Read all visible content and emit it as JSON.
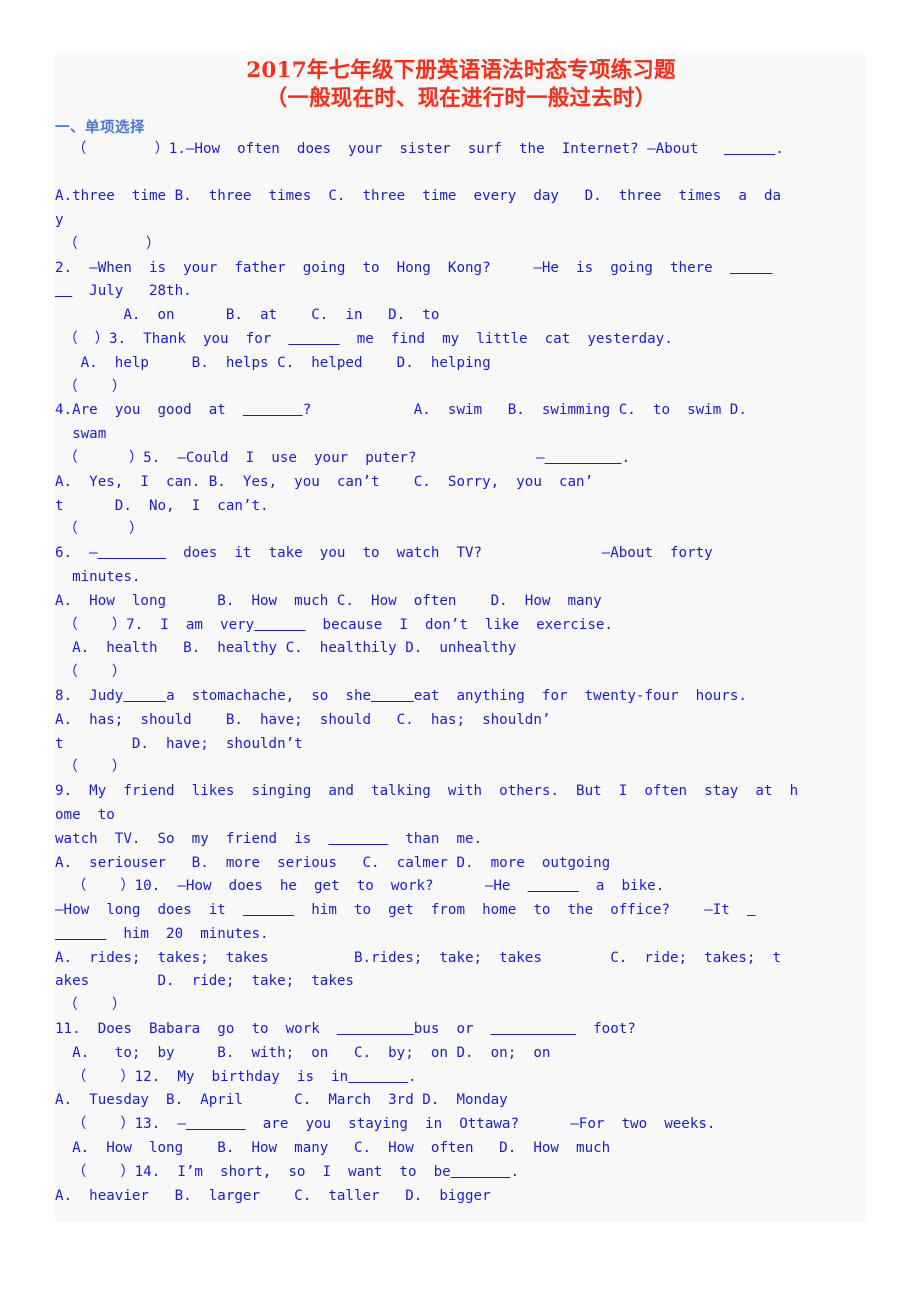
{
  "document": {
    "title_line_1": "2017年七年级下册英语语法时态专项练习题",
    "title_line_2": "（一般现在时、现在进行时一般过去时）",
    "section_heading": "一、单项选择",
    "colors": {
      "title_red": "#ff2a14",
      "body_blue": "#1a1ae0",
      "heading_blue": "#4a78d8",
      "page_background": "#f8f8f8",
      "canvas_background": "#ffffff"
    },
    "lines": [
      "  （        ）1.—How  often  does  your  sister  surf  the  Internet? —About   ______.",
      "",
      "A.three  time B.  three  times  C.  three  time  every  day   D.  three  times  a  da",
      "y",
      " （        ）",
      "2.  —When  is  your  father  going  to  Hong  Kong?     —He  is  going  there  _____",
      "__  July   28th.",
      "        A.  on      B.  at    C.  in   D.  to",
      " （  ）3.  Thank  you  for  ______  me  find  my  little  cat  yesterday.",
      "   A.  help     B.  helps C.  helped    D.  helping",
      " （    ）",
      "4.Are  you  good  at  _______?            A.  swim   B.  swimming C.  to  swim D.",
      "  swam",
      " （      ）5.  —Could  I  use  your  puter?              —_________.",
      "A.  Yes,  I  can. B.  Yes,  you  can’t    C.  Sorry,  you  can’",
      "t      D.  No,  I  can’t.",
      " （      ）",
      "6.  —________  does  it  take  you  to  watch  TV?              —About  forty",
      "  minutes.",
      "A.  How  long      B.  How  much C.  How  often    D.  How  many",
      " （    ）7.  I  am  very______  because  I  don’t  like  exercise.",
      "  A.  health   B.  healthy C.  healthily D.  unhealthy",
      " （    ）",
      "8.  Judy_____a  stomachache,  so  she_____eat  anything  for  twenty-four  hours.",
      "A.  has;  should    B.  have;  should   C.  has;  shouldn’",
      "t        D.  have;  shouldn’t",
      " （    ）",
      "9.  My  friend  likes  singing  and  talking  with  others.  But  I  often  stay  at  h",
      "ome  to",
      "watch  TV.  So  my  friend  is  _______  than  me.",
      "A.  seriouser   B.  more  serious   C.  calmer D.  more  outgoing",
      "  （    ）10.  —How  does  he  get  to  work?      —He  ______  a  bike.",
      "—How  long  does  it  ______  him  to  get  from  home  to  the  office?    —It  _",
      "______  him  20  minutes.",
      "A.  rides;  takes;  takes          B.rides;  take;  takes        C.  ride;  takes;  t",
      "akes        D.  ride;  take;  takes",
      " （    ）",
      "11.  Does  Babara  go  to  work  _________bus  or  __________  foot?",
      "  A.   to;  by     B.  with;  on   C.  by;  on D.  on;  on",
      "  （    ）12.  My  birthday  is  in_______.",
      "A.  Tuesday  B.  April      C.  March  3rd D.  Monday",
      "  （    ）13.  —_______  are  you  staying  in  Ottawa?      —For  two  weeks.",
      "  A.  How  long    B.  How  many   C.  How  often   D.  How  much",
      "  （    ）14.  I’m  short,  so  I  want  to  be_______.",
      "A.  heavier   B.  larger    C.  taller   D.  bigger"
    ]
  }
}
